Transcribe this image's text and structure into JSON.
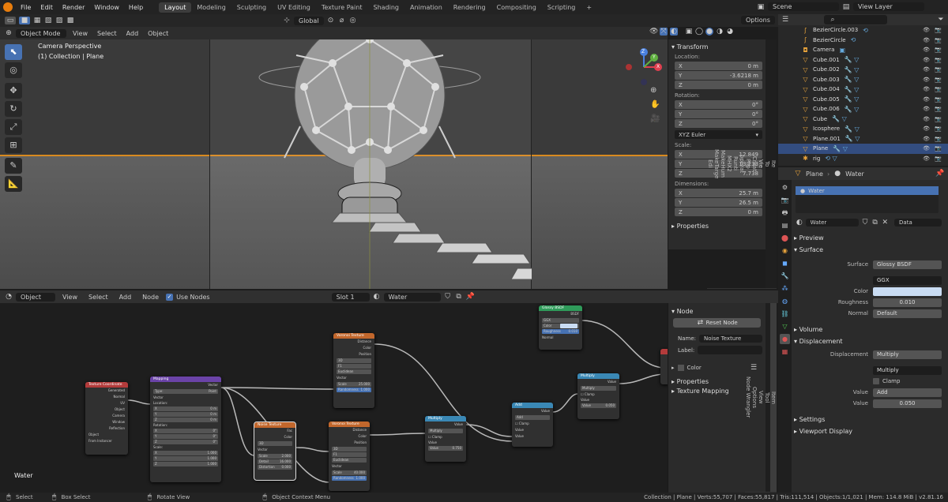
{
  "topbar": {
    "menus": [
      "File",
      "Edit",
      "Render",
      "Window",
      "Help"
    ],
    "workspaces": [
      "Layout",
      "Modeling",
      "Sculpting",
      "UV Editing",
      "Texture Paint",
      "Shading",
      "Animation",
      "Rendering",
      "Compositing",
      "Scripting"
    ],
    "active_workspace": "Layout",
    "add_tab": "+",
    "scene": "Scene",
    "view_layer": "View Layer"
  },
  "viewport": {
    "mode": "Object Mode",
    "menus": [
      "View",
      "Select",
      "Add",
      "Object"
    ],
    "transform_orientation": "Global",
    "options": "Options",
    "overlay_title": "Camera Perspective",
    "overlay_sub": "(1) Collection | Plane",
    "gizmo": {
      "x": "X",
      "y": "Y",
      "z": "Z"
    }
  },
  "npanel": {
    "transform_title": "Transform",
    "location_label": "Location:",
    "location": [
      {
        "axis": "X",
        "value": "0 m"
      },
      {
        "axis": "Y",
        "value": "-3.6218 m"
      },
      {
        "axis": "Z",
        "value": "0 m"
      }
    ],
    "rotation_label": "Rotation:",
    "rotation": [
      {
        "axis": "X",
        "value": "0°"
      },
      {
        "axis": "Y",
        "value": "0°"
      },
      {
        "axis": "Z",
        "value": "0°"
      }
    ],
    "rotation_mode": "XYZ Euler",
    "scale_label": "Scale:",
    "scale": [
      {
        "axis": "X",
        "value": "12.849"
      },
      {
        "axis": "Y",
        "value": "13.233"
      },
      {
        "axis": "Z",
        "value": "7.738"
      }
    ],
    "dimensions_label": "Dimensions:",
    "dimensions": [
      {
        "axis": "X",
        "value": "25.7 m"
      },
      {
        "axis": "Y",
        "value": "26.5 m"
      },
      {
        "axis": "Z",
        "value": "0 m"
      }
    ],
    "properties_title": "Properties",
    "tabs": [
      "Ite",
      "To",
      "Vie",
      "Creat",
      "Pap",
      "pperat",
      "Runti",
      "MHX2",
      "MakeHum",
      "MakeTarge",
      "Edi"
    ]
  },
  "outliner": {
    "search_icon": "search-icon",
    "items": [
      {
        "name": "BezierCircle.003",
        "icon": "curve"
      },
      {
        "name": "BezierCircle",
        "icon": "curve"
      },
      {
        "name": "Camera",
        "icon": "camera"
      },
      {
        "name": "Cube.001",
        "icon": "mesh"
      },
      {
        "name": "Cube.002",
        "icon": "mesh"
      },
      {
        "name": "Cube.003",
        "icon": "mesh"
      },
      {
        "name": "Cube.004",
        "icon": "mesh"
      },
      {
        "name": "Cube.005",
        "icon": "mesh"
      },
      {
        "name": "Cube.006",
        "icon": "mesh"
      },
      {
        "name": "Cube",
        "icon": "mesh"
      },
      {
        "name": "Icosphere",
        "icon": "mesh"
      },
      {
        "name": "Plane.001",
        "icon": "mesh"
      },
      {
        "name": "Plane",
        "icon": "mesh",
        "selected": true
      },
      {
        "name": "rig",
        "icon": "armature"
      }
    ]
  },
  "properties": {
    "object_name": "Plane",
    "material_name": "Water",
    "slot_item": "Water",
    "material_field": "Water",
    "data_select": "Data",
    "sections": {
      "preview": "Preview",
      "surface": "Surface",
      "volume": "Volume",
      "displacement": "Displacement",
      "settings": "Settings",
      "viewport_display": "Viewport Display"
    },
    "surface_label": "Surface",
    "surface_value": "Glossy BSDF",
    "distribution": "GGX",
    "color_label": "Color",
    "roughness_label": "Roughness",
    "roughness_value": "0.010",
    "normal_label": "Normal",
    "normal_value": "Default",
    "disp_label": "Displacement",
    "disp_value": "Multiply",
    "disp_op": "Multiply",
    "clamp_label": "Clamp",
    "value1_label": "Value",
    "value1_value": "Add",
    "value2_label": "Value",
    "value2_value": "0.050",
    "colors": {
      "color_swatch": "#c9dcf3"
    }
  },
  "node_editor": {
    "editor_mode": "Object",
    "menus": [
      "View",
      "Select",
      "Add",
      "Node"
    ],
    "use_nodes": "Use Nodes",
    "slot": "Slot 1",
    "material": "Water",
    "corner_label": "Water"
  },
  "nodes": {
    "texcoord": {
      "title": "Texture Coordinate",
      "outputs": [
        "Generated",
        "Normal",
        "UV",
        "Object",
        "Camera",
        "Window",
        "Reflection"
      ],
      "object_label": "Object",
      "from_instancer": "From Instancer"
    },
    "mapping": {
      "title": "Mapping",
      "output": "Vector",
      "type_label": "Type:",
      "type_value": "Point",
      "vector": "Vector",
      "location": "Location:",
      "rotation": "Rotation:",
      "scale": "Scale:",
      "loc": [
        [
          "X",
          "0 m"
        ],
        [
          "Y",
          "0 m"
        ],
        [
          "Z",
          "0 m"
        ]
      ],
      "rot": [
        [
          "X",
          "0°"
        ],
        [
          "Y",
          "0°"
        ],
        [
          "Z",
          "0°"
        ]
      ],
      "scl": [
        [
          "X",
          "1.000"
        ],
        [
          "Y",
          "1.000"
        ],
        [
          "Z",
          "1.000"
        ]
      ]
    },
    "voronoi1": {
      "title": "Voronoi Texture",
      "outputs": [
        "Distance",
        "Color",
        "Position"
      ],
      "dim": "3D",
      "feature": "F1",
      "metric": "Euclidean",
      "vector": "Vector",
      "scale": [
        "Scale",
        "25.000"
      ],
      "rand": [
        "Randomness",
        "1.000"
      ]
    },
    "noise": {
      "title": "Noise Texture",
      "outputs": [
        "Fac",
        "Color"
      ],
      "dim": "3D",
      "vector": "Vector",
      "scale": [
        "Scale",
        "2.000"
      ],
      "detail": [
        "Detail",
        "16.000"
      ],
      "distortion": [
        "Distortion",
        "0.000"
      ]
    },
    "voronoi2": {
      "title": "Voronoi Texture",
      "outputs": [
        "Distance",
        "Color",
        "Position"
      ],
      "dim": "3D",
      "feature": "F1",
      "metric": "Euclidean",
      "vector": "Vector",
      "scale": [
        "Scale",
        "40.000"
      ],
      "rand": [
        "Randomness",
        "1.000"
      ]
    },
    "multiply1": {
      "title": "Multiply",
      "output": "Value",
      "op": "Multiply",
      "clamp": "Clamp",
      "value": "Value",
      "value2": [
        "Value",
        "0.750"
      ]
    },
    "add": {
      "title": "Add",
      "output": "Value",
      "op": "Add",
      "clamp": "Clamp",
      "v1": "Value",
      "v2": "Value"
    },
    "multiply2": {
      "title": "Multiply",
      "output": "Value",
      "op": "Multiply",
      "clamp": "Clamp",
      "value": "Value",
      "value2": [
        "Value",
        "0.050"
      ]
    },
    "glossy": {
      "title": "Glossy BSDF",
      "output": "BSDF",
      "dist": "GGX",
      "color": "Color",
      "rough": [
        "Roughness",
        "0.010"
      ],
      "normal": "Normal"
    }
  },
  "node_sidebar": {
    "title": "Node",
    "reset": "Reset Node",
    "name_label": "Name:",
    "name_value": "Noise Texture",
    "label_label": "Label:",
    "color": "Color",
    "properties": "Properties",
    "texture_mapping": "Texture Mapping",
    "tabs": [
      "Item",
      "Tool",
      "View",
      "Options",
      "Node Wrangler"
    ]
  },
  "status": {
    "select": "Select",
    "box_select": "Box Select",
    "rotate_view": "Rotate View",
    "context_menu": "Object Context Menu",
    "stats": "Collection | Plane | Verts:55,707 | Faces:55,817 | Tris:111,514 | Objects:1/1,021 | Mem: 114.8 MiB | v2.81.16"
  }
}
